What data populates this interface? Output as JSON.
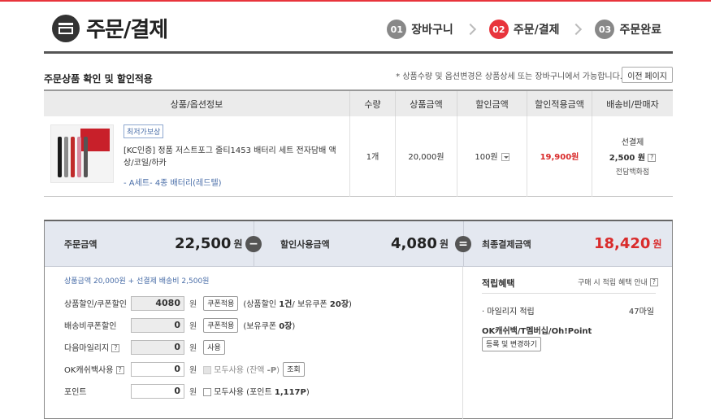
{
  "header": {
    "title": "주문/결제",
    "steps": [
      {
        "num": "01",
        "label": "장바구니"
      },
      {
        "num": "02",
        "label": "주문/결제"
      },
      {
        "num": "03",
        "label": "주문완료"
      }
    ]
  },
  "section": {
    "title": "주문상품 확인 및 할인적용",
    "note": "* 상품수량 및 옵션변경은 상품상세 또는 장바구니에서 가능합니다.",
    "prev_button": "이전 페이지"
  },
  "table": {
    "headers": [
      "상품/옵션정보",
      "수량",
      "상품금액",
      "할인금액",
      "할인적용금액",
      "배송비/판매자"
    ],
    "row": {
      "badge": "최저가보상",
      "name": "[KC인증] 정품 저스트포그 줄티1453 배터리 세트 전자담배 액상/코일/하카",
      "option": "- A세트- 4종 배터리(레드텔)",
      "qty": "1개",
      "price": "20,000원",
      "discount": "100원",
      "final_price": "19,900원",
      "shipping_type": "선결제",
      "shipping_fee": "2,500 원",
      "seller": "전담백화점"
    }
  },
  "summary": {
    "order_label": "주문금액",
    "order_value": "22,500",
    "discount_label": "할인사용금액",
    "discount_value": "4,080",
    "final_label": "최종결제금액",
    "final_value": "18,420",
    "unit": "원",
    "minus": "−",
    "equals": "=",
    "breakdown": "상품금액 20,000원 + 선결제 배송비 2,500원"
  },
  "fields": [
    {
      "label": "상품할인/쿠폰할인",
      "value": "4080",
      "button": "쿠폰적용",
      "note_prefix": "(상품할인 ",
      "note_count": "1건",
      "note_mid": "/ 보유쿠폰 ",
      "note_count2": "20장",
      "note_suffix": ")"
    },
    {
      "label": "배송비쿠폰할인",
      "value": "0",
      "button": "쿠폰적용",
      "note_prefix": "(보유쿠폰 ",
      "note_count": "0장",
      "note_suffix": ")"
    },
    {
      "label": "다음마일리지",
      "value": "0",
      "button": "사용"
    },
    {
      "label": "OK캐쉬백사용",
      "value": "0",
      "check_label": "모두사용 (잔액 ",
      "check_value": "-P",
      "check_suffix": ")",
      "button": "조회"
    },
    {
      "label": "포인트",
      "value": "0",
      "check_label": "모두사용 (포인트 ",
      "check_value": "1,117P",
      "check_suffix": ")"
    }
  ],
  "field_unit": "원",
  "rewards": {
    "title": "적립혜택",
    "note": "구매 시 적립 혜택 안내",
    "mileage_label": "· 마일리지 적립",
    "mileage_value": "47마일",
    "ok_label": "OK캐쉬백/T멤버십/Oh!Point",
    "register_button": "등록 및 변경하기"
  },
  "colors": {
    "accent": "#e8343c",
    "final_red": "#d92b2b",
    "summary_bg": "#e4e8f0"
  }
}
